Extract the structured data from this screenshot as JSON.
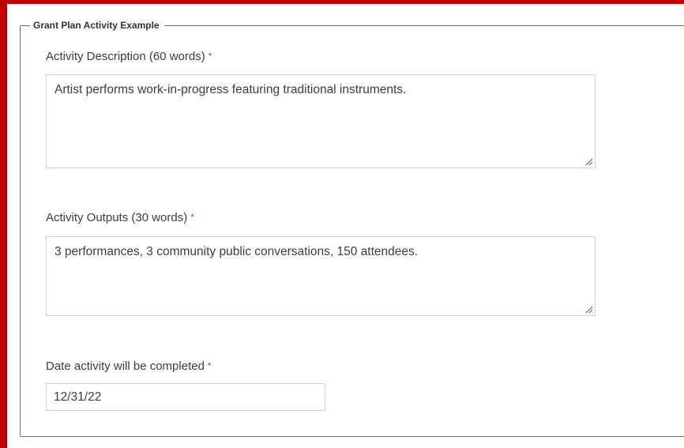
{
  "section": {
    "legend": "Grant Plan Activity Example"
  },
  "fields": {
    "activity_description": {
      "label": "Activity Description (60 words)",
      "required_mark": "*",
      "value": "Artist performs work-in-progress featuring traditional instruments."
    },
    "activity_outputs": {
      "label": "Activity Outputs (30 words)",
      "required_mark": "*",
      "value": "3 performances, 3 community public conversations, 150 attendees."
    },
    "completion_date": {
      "label": "Date activity will be completed",
      "required_mark": "*",
      "value": "12/31/22"
    }
  },
  "colors": {
    "frame_border": "#c00000",
    "required_mark": "#cf3a3a",
    "input_border": "#d0d0d0"
  },
  "icons": {
    "textarea_resize": "resize-grip-icon"
  }
}
